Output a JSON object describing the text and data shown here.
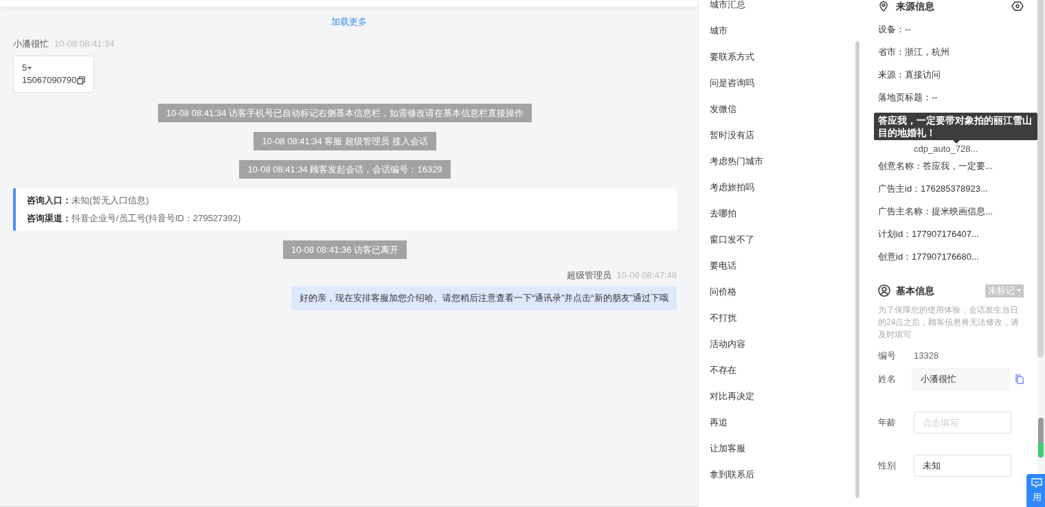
{
  "chat": {
    "load_more": "加载更多",
    "messages": [
      {
        "kind": "visitor",
        "name": "小潘很忙",
        "time": "10-08 08:41:34",
        "lines": [
          "5+",
          "15067090790"
        ]
      },
      {
        "kind": "notice",
        "text": "10-08 08:41:34 访客手机号已自动标记右侧基本信息栏，如需修改请在基本信息栏直接操作"
      },
      {
        "kind": "notice",
        "text": "10-08 08:41:34 客服 超级管理员 接入会话"
      },
      {
        "kind": "notice",
        "text": "10-08 08:41:34 顾客发起会话，会话编号：16329"
      },
      {
        "kind": "card",
        "fields": [
          {
            "label": "咨询入口：",
            "value": "未知(暂无入口信息)"
          },
          {
            "label": "咨询渠道：",
            "value": "抖音企业号/员工号(抖音号ID：279527392)"
          }
        ]
      },
      {
        "kind": "notice",
        "text": "10-08 08:41:36 访客已离开"
      },
      {
        "kind": "agent",
        "name": "超级管理员",
        "time": "10-08 08:47:48",
        "text": "好的亲，现在安排客服加您介绍哈。请您稍后注意查看一下“通讯录”并点击“新的朋友”通过下哦"
      }
    ]
  },
  "quick_replies": [
    "城市汇总",
    "城市",
    "要联系方式",
    "问是咨询吗",
    "发微信",
    "暂时没有店",
    "考虑热门城市",
    "考虑旅拍吗",
    "去哪拍",
    "窗口发不了",
    "要电话",
    "问价格",
    "不打扰",
    "活动内容",
    "不存在",
    "对比再决定",
    "再追",
    "让加客服",
    "拿到联系后"
  ],
  "source_info": {
    "title": "来源信息",
    "rows": [
      {
        "kind": "row",
        "text": "设备：--"
      },
      {
        "kind": "row",
        "text": "省市：浙江，杭州"
      },
      {
        "kind": "row",
        "text": "来源：直接访问"
      },
      {
        "kind": "row",
        "text": "落地页标题：--"
      },
      {
        "kind": "tooltip",
        "text": "答应我，一定要带对象拍的丽江雪山目的地婚礼！"
      },
      {
        "kind": "partial",
        "text": "cdp_auto_728..."
      },
      {
        "kind": "row",
        "text": "创意名称：答应我，一定要..."
      },
      {
        "kind": "row",
        "text": "广告主id：176285378923..."
      },
      {
        "kind": "row",
        "text": "广告主名称：提米映画信息..."
      },
      {
        "kind": "row",
        "text": "计划id：177907176407..."
      },
      {
        "kind": "row",
        "text": "创意id：177907176680..."
      }
    ]
  },
  "basic_info": {
    "title": "基本信息",
    "tag": "未标记",
    "notice": "为了保障您的使用体验，会话发生当日的24点之后，顾客信息将无法修改，请及时填写",
    "number_label": "编号",
    "number": "13328",
    "fields": [
      {
        "label": "姓名",
        "value": "小潘很忙",
        "kind": "filled"
      },
      {
        "label": "年龄",
        "placeholder": "点击填写",
        "kind": "input"
      },
      {
        "label": "性别",
        "value": "未知",
        "kind": "input"
      }
    ]
  },
  "float_button": "用"
}
